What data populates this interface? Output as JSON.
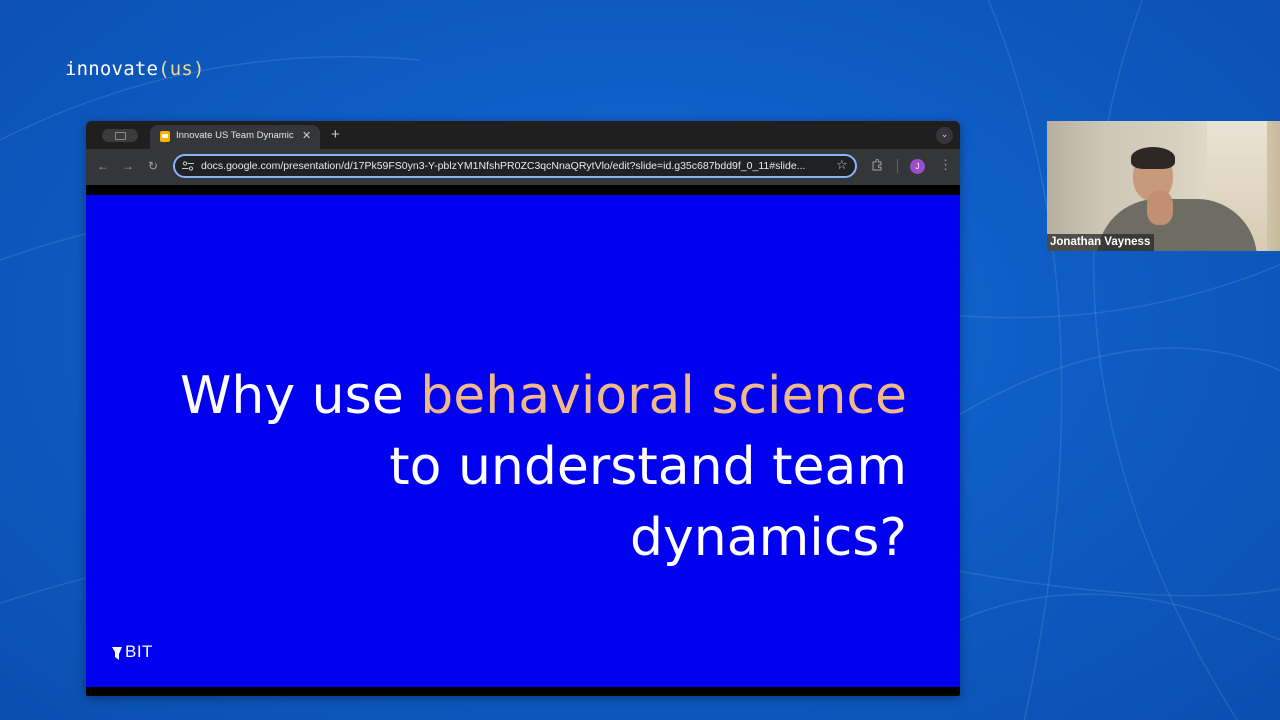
{
  "brand": {
    "name": "innovate",
    "open": "(",
    "arg": "us",
    "close": ")"
  },
  "browser": {
    "tab_title": "Innovate US Team Dynamics",
    "tab_close": "✕",
    "new_tab": "+",
    "tab_menu": "⌄",
    "nav_back": "←",
    "nav_forward": "→",
    "nav_reload": "↻",
    "url": "docs.google.com/presentation/d/17Pk59FS0yn3-Y-pblzYM1NfshPR0ZC3qcNnaQRytVlo/edit?slide=id.g35c687bdd9f_0_11#slide...",
    "bookmark": "☆",
    "profile_initial": "J",
    "menu": "⋮"
  },
  "slide": {
    "line1_plain": "Why use ",
    "line1_accent": "behavioral science",
    "line2": "to understand team",
    "line3": "dynamics?",
    "logo_text": "BIT"
  },
  "webcam": {
    "participant_name": "Jonathan Vayness"
  },
  "colors": {
    "slide_bg": "#0000f0",
    "accent": "#f1b98a",
    "omnibox_focus": "#8ab4f8"
  }
}
